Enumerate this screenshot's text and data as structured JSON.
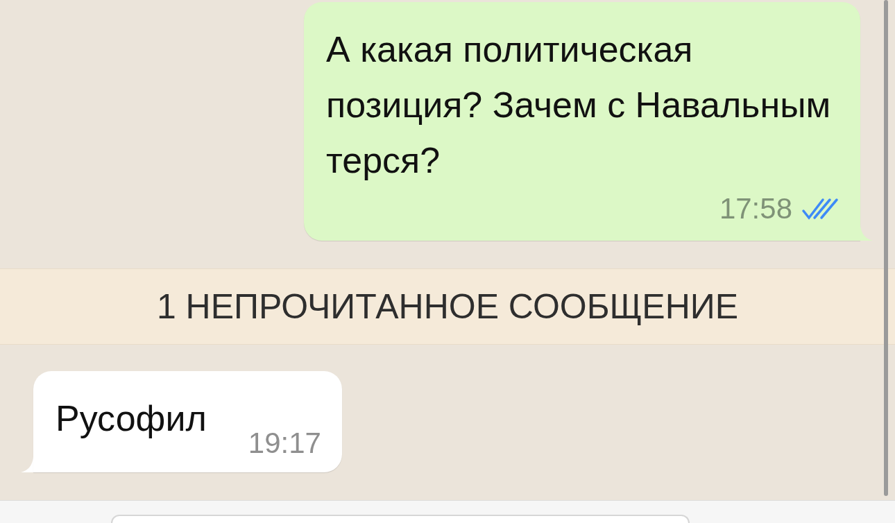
{
  "chat": [
    {
      "kind": "outgoing",
      "text": "А какая политическая позиция? Зачем с Навальным терся?",
      "time": "17:58",
      "read": true
    },
    {
      "kind": "unread_divider",
      "text": "1 НЕПРОЧИТАННОЕ СООБЩЕНИЕ"
    },
    {
      "kind": "incoming",
      "text": "Русофил",
      "time": "19:17"
    }
  ]
}
